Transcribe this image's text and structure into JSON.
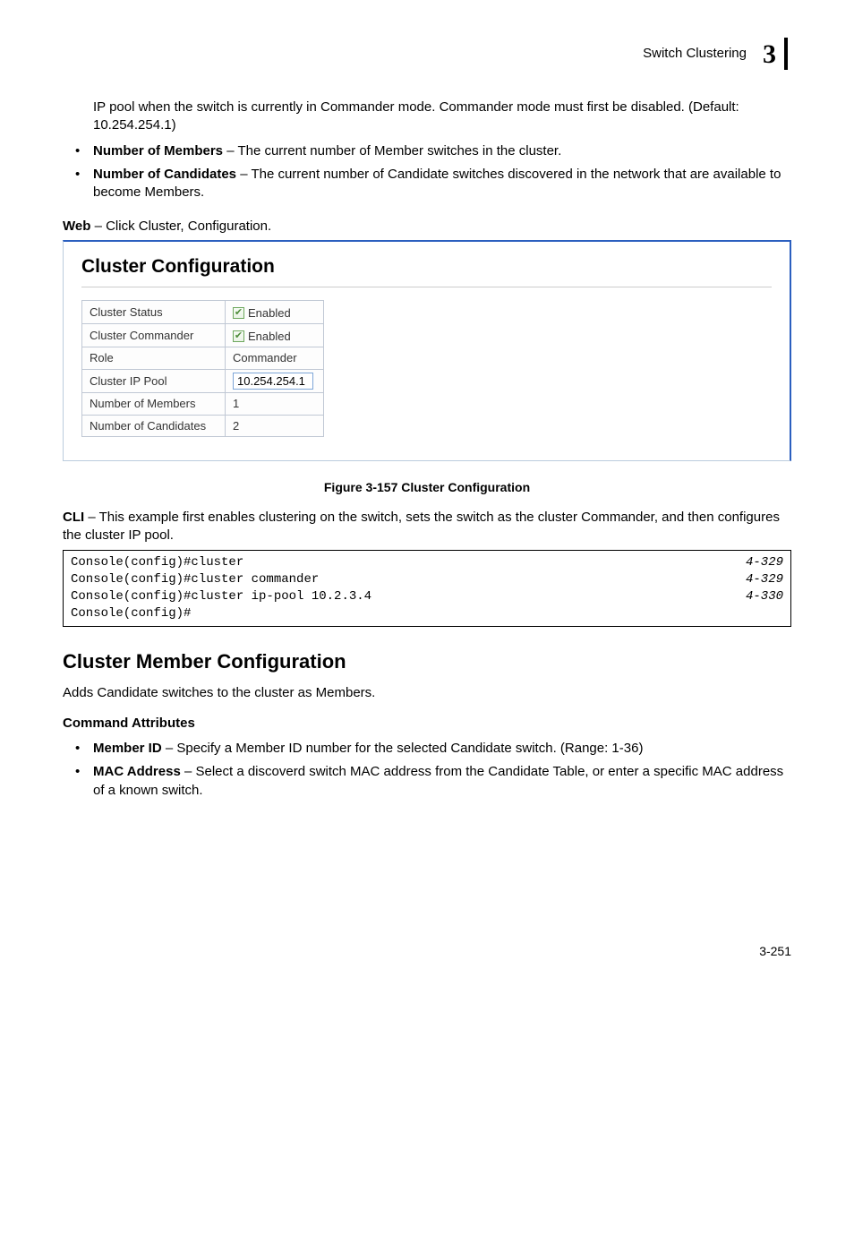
{
  "header": {
    "title": "Switch Clustering",
    "chapter_number": "3"
  },
  "intro_paragraph": "IP pool when the switch is currently in Commander mode. Commander mode must first be disabled. (Default: 10.254.254.1)",
  "bullets1": [
    {
      "term": "Number of Members",
      "desc": " – The current number of Member switches in the cluster."
    },
    {
      "term": "Number of Candidates",
      "desc": " – The current number of Candidate switches discovered in the network that are available to become Members."
    }
  ],
  "web_nav": {
    "prefix": "Web",
    "rest": " – Click Cluster, Configuration."
  },
  "panel": {
    "title": "Cluster Configuration",
    "rows": {
      "status_label": "Cluster Status",
      "status_enabled": "Enabled",
      "commander_label": "Cluster Commander",
      "commander_enabled": "Enabled",
      "role_label": "Role",
      "role_value": "Commander",
      "ippool_label": "Cluster IP Pool",
      "ippool_value": "10.254.254.1",
      "members_label": "Number of Members",
      "members_value": "1",
      "candidates_label": "Number of Candidates",
      "candidates_value": "2"
    }
  },
  "figure_caption": "Figure 3-157  Cluster Configuration",
  "cli_para": {
    "prefix": "CLI",
    "rest": " – This example first enables clustering on the switch, sets the switch as the cluster Commander, and then configures the cluster IP pool."
  },
  "code": {
    "lines": [
      "Console(config)#cluster",
      "Console(config)#cluster commander",
      "Console(config)#cluster ip-pool 10.2.3.4",
      "Console(config)#"
    ],
    "refs": [
      "4-329",
      "4-329",
      "4-330",
      ""
    ]
  },
  "section_heading": "Cluster Member Configuration",
  "section_para": "Adds Candidate switches to the cluster as Members.",
  "cmd_attr_heading": "Command Attributes",
  "bullets2": [
    {
      "term": "Member ID",
      "desc": " – Specify a Member ID number for the selected Candidate switch. (Range: 1-36)"
    },
    {
      "term": "MAC Address",
      "desc": " – Select a discoverd switch MAC address from the Candidate Table, or enter a specific MAC address of a known switch."
    }
  ],
  "page_number": "3-251"
}
